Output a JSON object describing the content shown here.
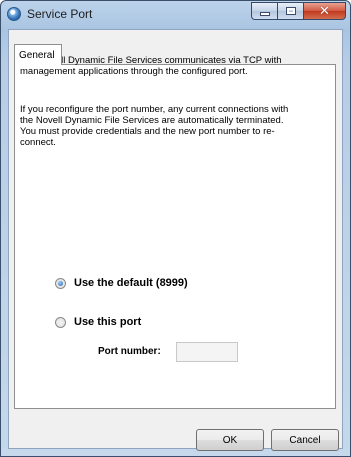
{
  "window": {
    "title": "Service Port"
  },
  "tabs": [
    {
      "label": "General"
    }
  ],
  "content": {
    "paragraph1": "The Novell Dynamic File Services communicates via TCP with management applications through the configured port.",
    "paragraph2": "If you reconfigure the port number, any current connections with the Novell Dynamic File Services are automatically terminated. You must provide credentials and the new port number to re-connect."
  },
  "options": {
    "default_label": "Use the default (8999)",
    "custom_label": "Use this port",
    "selected": "default"
  },
  "port": {
    "label": "Port number:",
    "value": ""
  },
  "buttons": {
    "ok": "OK",
    "cancel": "Cancel"
  },
  "colors": {
    "close_button": "#c9442a",
    "title_bar": "#a9c4e2",
    "radio_selected": "#1e5ea8"
  },
  "icons": {
    "app": "app-icon",
    "minimize": "minimize-icon",
    "maximize": "maximize-icon",
    "close": "close-icon"
  }
}
